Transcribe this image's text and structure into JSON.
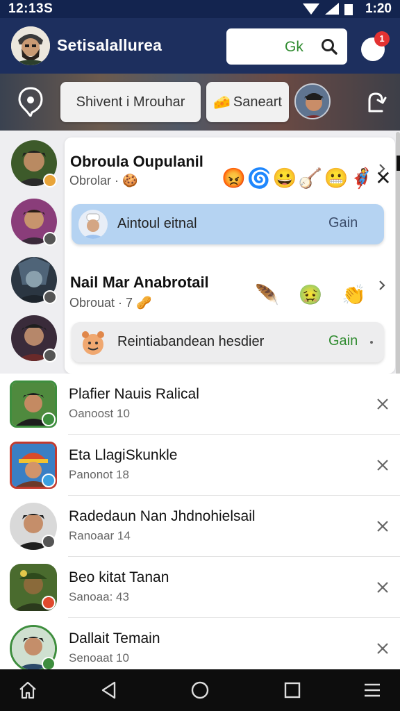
{
  "status": {
    "time_left": "12:13S",
    "time_right": "1:20"
  },
  "header": {
    "title": "Setisalallurea",
    "search_value": "Gk",
    "notification_count": "1",
    "brand_color": "#1d2f5e"
  },
  "toolbar": {
    "chip_one": "Shivent i Mrouhar",
    "chip_two_emoji": "🧀",
    "chip_two_label": "Saneart"
  },
  "featured": {
    "card_one": {
      "title": "Obroula Oupulanil",
      "subtitle": "Obrolar ·",
      "subtitle_emoji": "🍪",
      "emojis": "😡🌀😀🪕😬🦸✕"
    },
    "pill_one": {
      "text": "Aintoul eitnal",
      "action": "Gain"
    },
    "card_two": {
      "title": "Nail Mar Anabrotail",
      "subtitle": "Obrouat · 7",
      "subtitle_emoji": "🥜",
      "emojis": "🪶 🤢 👏"
    },
    "pill_two": {
      "text": "Reintiabandean hesdier",
      "action": "Gain"
    }
  },
  "list": [
    {
      "name": "Plafier Nauis Ralical",
      "meta": "Oanoost 10"
    },
    {
      "name": "Eta LlagiSkunkle",
      "meta": "Panonot 18"
    },
    {
      "name": "Radedaun Nan Jhdnohielsail",
      "meta": "Ranoaar 14"
    },
    {
      "name": "Beo kitat Tanan",
      "meta": "Sanoaa: 43"
    },
    {
      "name": "Dallait Temain",
      "meta": "Senoaat 10"
    }
  ],
  "icons": {
    "header_avatar": "bearded-man-avatar-icon",
    "search": "search-icon",
    "notification": "notification-bubble-icon",
    "location": "location-pin-icon",
    "share": "share-icon",
    "chevron": "chevron-right-icon",
    "close": "close-icon",
    "nav": [
      "home-icon",
      "back-icon",
      "circle-home-icon",
      "recents-icon",
      "menu-icon"
    ]
  },
  "colors": {
    "accent_green": "#2f8b2f",
    "badge_red": "#e33232",
    "pill_blue": "#b5d3f2"
  }
}
